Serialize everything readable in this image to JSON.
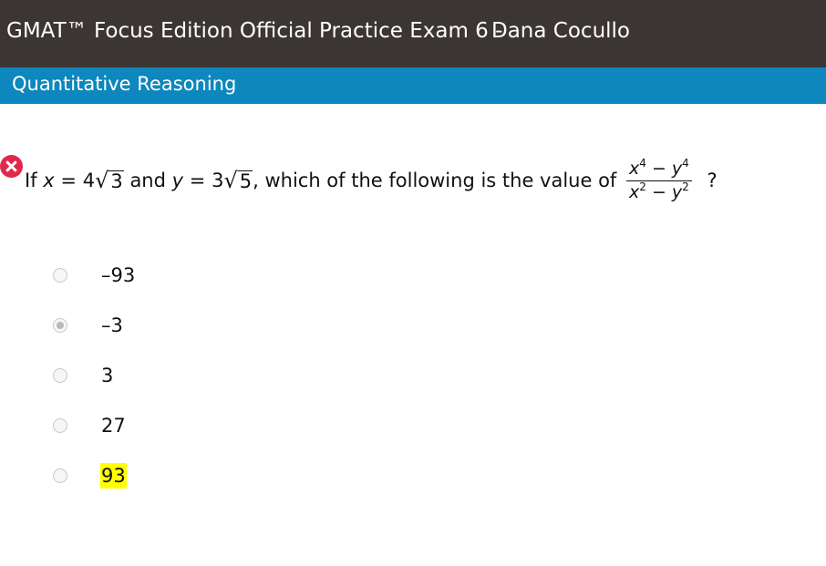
{
  "header": {
    "exam_title": "GMAT™ Focus Edition Official Practice Exam 6 -",
    "user_name": "Dana Cocullo"
  },
  "section": {
    "title": "Quantitative Reasoning"
  },
  "question": {
    "status_icon": "incorrect-x-icon",
    "status_color": "#e0294a",
    "prefix": "If",
    "x_var": "x",
    "equals_1": "=",
    "x_coef": "4",
    "x_radical": "√",
    "x_radicand": "3",
    "connector": "and",
    "y_var": "y",
    "equals_2": "=",
    "y_coef": "3",
    "y_radical": "√",
    "y_radicand": "5",
    "prompt_text": ", which of the following is the value of",
    "fraction": {
      "num_a": "x",
      "num_a_exp": "4",
      "num_op": "−",
      "num_b": "y",
      "num_b_exp": "4",
      "den_a": "x",
      "den_a_exp": "2",
      "den_op": "−",
      "den_b": "y",
      "den_b_exp": "2"
    },
    "suffix": "?"
  },
  "options": [
    {
      "label": "–93",
      "selected": false,
      "highlighted": false
    },
    {
      "label": "–3",
      "selected": true,
      "highlighted": false
    },
    {
      "label": "3",
      "selected": false,
      "highlighted": false
    },
    {
      "label": "27",
      "selected": false,
      "highlighted": false
    },
    {
      "label": "93",
      "selected": false,
      "highlighted": true
    }
  ],
  "colors": {
    "title_bar": "#3b3534",
    "section_bar": "#0d87bd",
    "highlight": "#ffff00"
  }
}
